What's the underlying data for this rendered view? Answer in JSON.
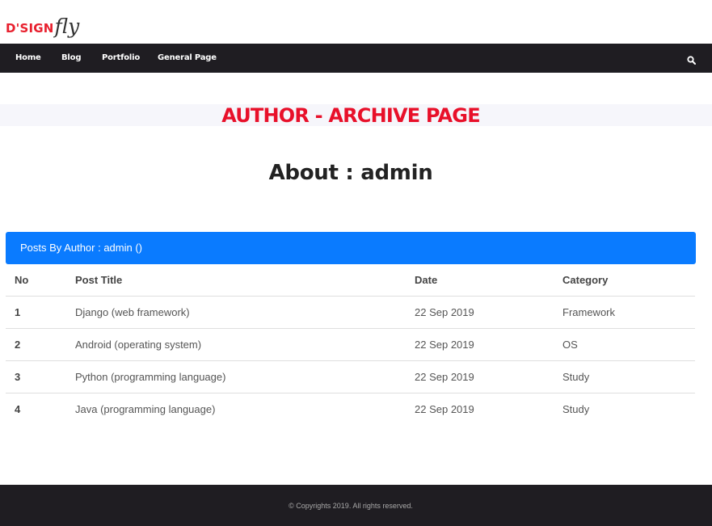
{
  "logo": {
    "main": "D'SIGN",
    "fly": "fly"
  },
  "nav": {
    "items": [
      {
        "label": "Home"
      },
      {
        "label": "Blog"
      },
      {
        "label": "Portfolio"
      },
      {
        "label": "General Page"
      }
    ],
    "search_icon": "search-icon"
  },
  "banner": {
    "title": "AUTHOR - ARCHIVE PAGE"
  },
  "about": {
    "text": "About : admin"
  },
  "posts": {
    "header": "Posts By Author : admin ()",
    "columns": {
      "no": "No",
      "title": "Post Title",
      "date": "Date",
      "category": "Category"
    },
    "rows": [
      {
        "no": "1",
        "title": "Django (web framework)",
        "date": "22 Sep 2019",
        "category": "Framework"
      },
      {
        "no": "2",
        "title": "Android (operating system)",
        "date": "22 Sep 2019",
        "category": "OS"
      },
      {
        "no": "3",
        "title": "Python (programming language)",
        "date": "22 Sep 2019",
        "category": "Study"
      },
      {
        "no": "4",
        "title": "Java (programming language)",
        "date": "22 Sep 2019",
        "category": "Study"
      }
    ]
  },
  "footer": {
    "copyright": "© Copyrights 2019. All rights reserved."
  },
  "colors": {
    "accent_red": "#e8102a",
    "panel_blue": "#0a7bff",
    "nav_bg": "#1f1d22"
  }
}
